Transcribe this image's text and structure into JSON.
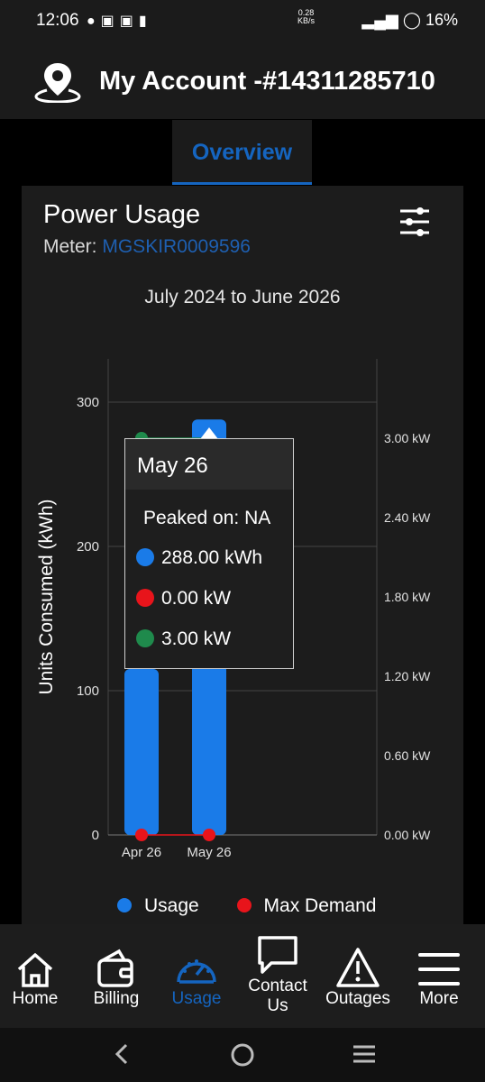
{
  "status_bar": {
    "time": "12:06",
    "net_line1": "0.28",
    "net_line2": "KB/s",
    "battery": "16%"
  },
  "header": {
    "title": "My Account -#14311285710",
    "icon": "location-pin-icon"
  },
  "tab": {
    "label": "Overview"
  },
  "card": {
    "title": "Power Usage",
    "meter_label": "Meter:",
    "meter_value": "MGSKIR0009596",
    "range": "July 2024 to June 2026"
  },
  "chart_data": {
    "type": "bar",
    "categories": [
      "Apr 26",
      "May 26"
    ],
    "ylabel": "Units Consumed (kWh)",
    "ylim": [
      0,
      330
    ],
    "y_ticks": [
      "300",
      "200",
      "100",
      "0"
    ],
    "y2lim": [
      0,
      3.6
    ],
    "y2_ticks": [
      "3.00 kW",
      "2.40 kW",
      "1.80 kW",
      "1.20 kW",
      "0.60 kW",
      "0.00 kW"
    ],
    "series": [
      {
        "name": "Usage",
        "type": "bar",
        "color": "#1a7be8",
        "values": [
          115,
          288
        ]
      },
      {
        "name": "Max Demand",
        "type": "line",
        "color": "#e8141b",
        "values": [
          0,
          0
        ]
      },
      {
        "type": "line",
        "color": "#1f8a4c",
        "values": [
          3.0,
          3.0
        ]
      }
    ],
    "legend": [
      "Usage",
      "Max Demand"
    ],
    "grid": true
  },
  "tooltip": {
    "title": "May 26",
    "peaked": "Peaked on: NA",
    "usage": "288.00 kWh",
    "max_demand": "0.00 kW",
    "green_value": "3.00 kW"
  },
  "legend": {
    "usage": "Usage",
    "max_demand": "Max Demand"
  },
  "nav": {
    "home": "Home",
    "billing": "Billing",
    "usage": "Usage",
    "contact_1": "Contact",
    "contact_2": "Us",
    "outages": "Outages",
    "more": "More"
  },
  "colors": {
    "accent": "#1565c0",
    "meter": "#1e5fb0"
  }
}
